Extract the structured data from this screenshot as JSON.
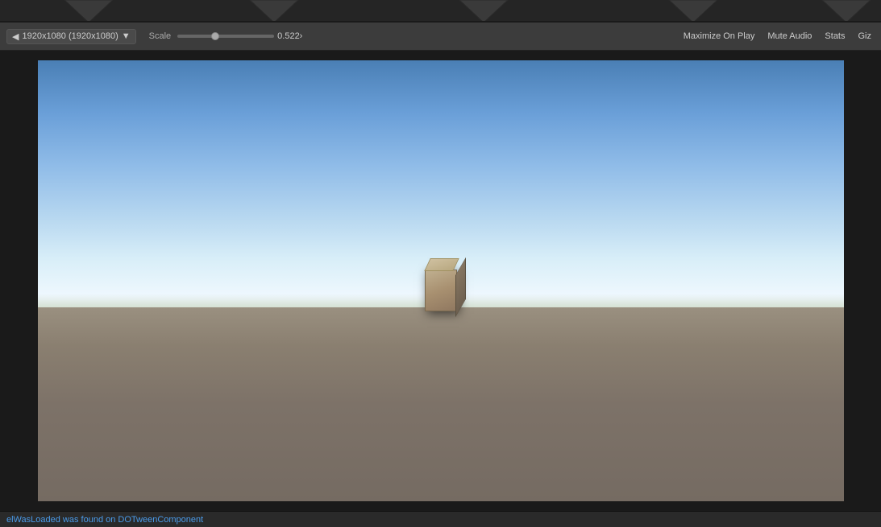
{
  "header": {
    "triangle_positions": [
      100,
      300,
      550,
      800,
      1000
    ]
  },
  "toolbar": {
    "resolution_label": "1920x1080 (1920x1080)",
    "resolution_arrow": "▼",
    "scale_label": "Scale",
    "scale_value": "0.522›",
    "maximize_label": "Maximize On Play",
    "mute_audio_label": "Mute Audio",
    "stats_label": "Stats",
    "gizmos_label": "Giz"
  },
  "status_bar": {
    "message": "elWasLoaded was found on DOTweenComponent"
  },
  "scene": {
    "cube_present": true
  }
}
